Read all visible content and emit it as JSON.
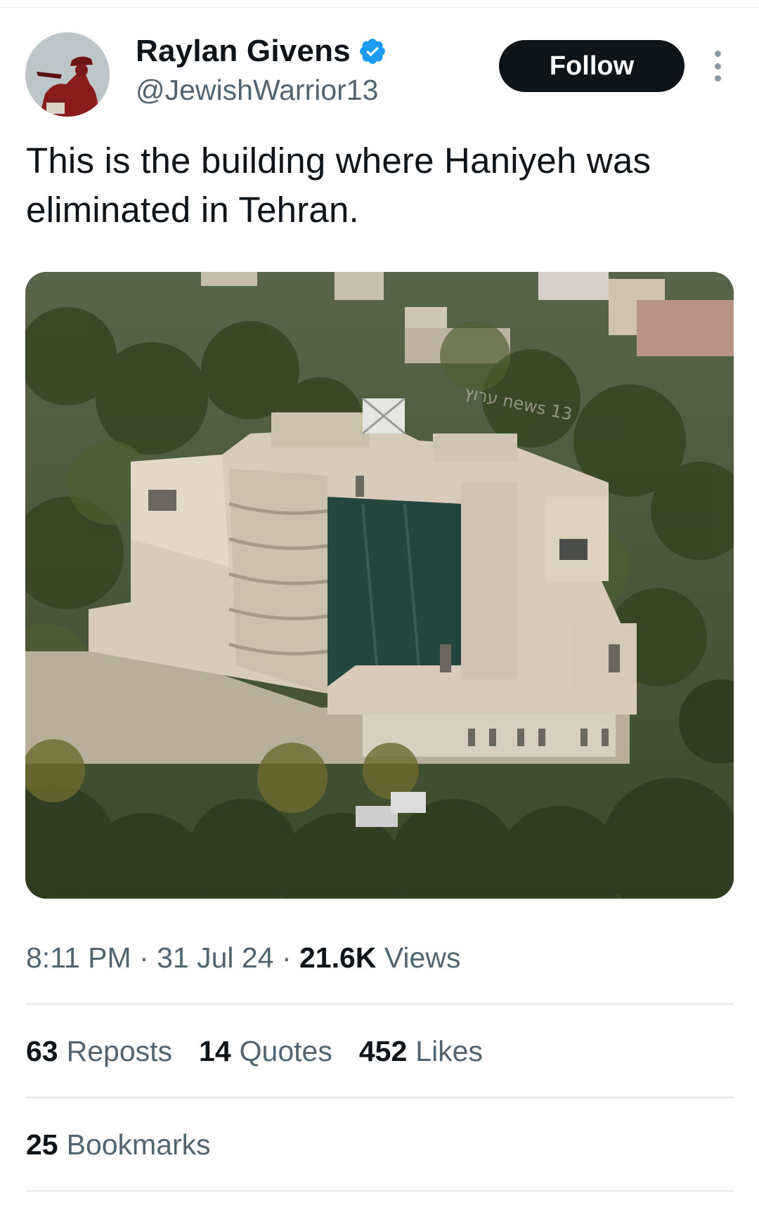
{
  "author": {
    "display_name": "Raylan Givens",
    "handle": "@JewishWarrior13",
    "verified": true
  },
  "follow_label": "Follow",
  "tweet": {
    "text": "This is the building where Haniyeh was eliminated in Tehran."
  },
  "media": {
    "watermark": "ערוץ news 13"
  },
  "meta": {
    "time": "8:11 PM",
    "separator": "·",
    "date": "31 Jul 24",
    "views_count": "21.6K",
    "views_label": "Views"
  },
  "stats": {
    "reposts": {
      "count": "63",
      "label": "Reposts"
    },
    "quotes": {
      "count": "14",
      "label": "Quotes"
    },
    "likes": {
      "count": "452",
      "label": "Likes"
    },
    "bookmarks": {
      "count": "25",
      "label": "Bookmarks"
    }
  },
  "colors": {
    "text_primary": "#0f1419",
    "text_secondary": "#536471",
    "verified_blue": "#1d9bf0",
    "follow_bg": "#0f1419",
    "divider": "#e6e9eb"
  },
  "icons": {
    "verified": "verified-badge-icon",
    "more": "more-options-icon"
  }
}
